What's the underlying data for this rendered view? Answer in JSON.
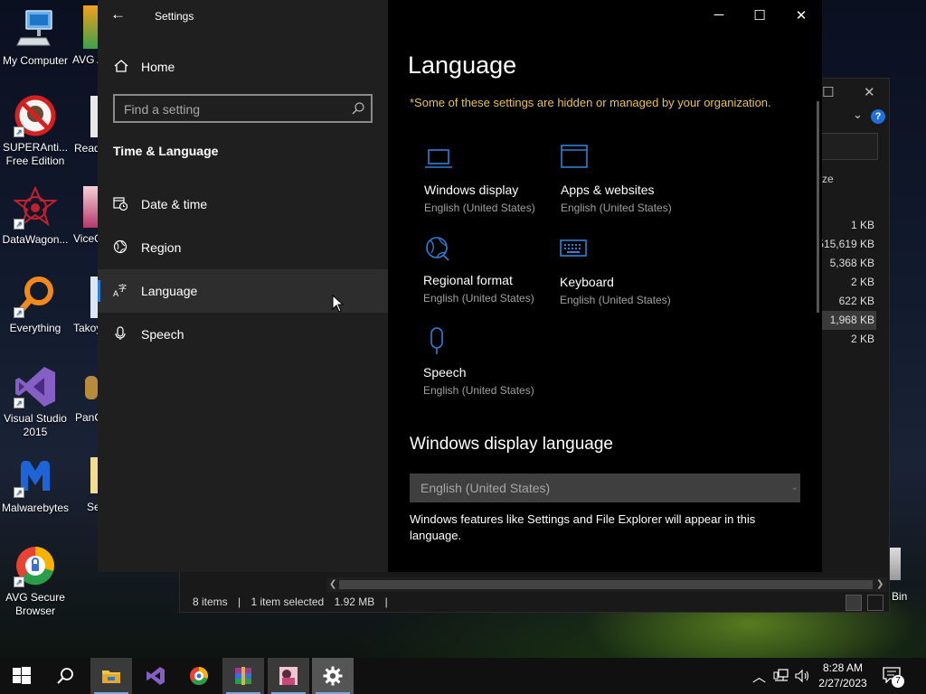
{
  "desktop": {
    "icons": [
      {
        "label": "My Computer",
        "icon": "computer-icon"
      },
      {
        "label": "SUPERAnti... Free Edition",
        "icon": "superantispyware-icon"
      },
      {
        "label": "DataWagon...",
        "icon": "datawagon-icon"
      },
      {
        "label": "Everything",
        "icon": "everything-search-icon"
      },
      {
        "label": "Visual Studio 2015",
        "icon": "visual-studio-icon"
      },
      {
        "label": "Malwarebytes",
        "icon": "malwarebytes-icon"
      },
      {
        "label": "AVG Secure Browser",
        "icon": "avg-browser-icon"
      }
    ],
    "partial_labels": [
      "AVG A",
      "Read",
      "ViceC",
      "Takoy",
      "PanC",
      "Se"
    ],
    "recycle_bin_label": "Bin"
  },
  "explorer": {
    "size_header": "ze",
    "sizes": [
      "1 KB",
      "515,619 KB",
      "5,368 KB",
      "2 KB",
      "622 KB",
      "1,968 KB",
      "2 KB"
    ],
    "selected_index": 5,
    "status": {
      "items": "8 items",
      "selected": "1 item selected",
      "size": "1.92 MB"
    }
  },
  "settings": {
    "window_title": "Settings",
    "home_label": "Home",
    "search_placeholder": "Find a setting",
    "section_title": "Time & Language",
    "nav_items": [
      {
        "label": "Date & time",
        "icon": "date-time-icon"
      },
      {
        "label": "Region",
        "icon": "region-globe-icon"
      },
      {
        "label": "Language",
        "icon": "language-icon",
        "active": true
      },
      {
        "label": "Speech",
        "icon": "microphone-icon"
      }
    ],
    "page_title": "Language",
    "managed_notice": "*Some of these settings are hidden or managed by your organization.",
    "tiles": [
      {
        "title": "Windows display",
        "subtitle": "English (United States)",
        "icon": "laptop-icon"
      },
      {
        "title": "Apps & websites",
        "subtitle": "English (United States)",
        "icon": "window-icon"
      },
      {
        "title": "Regional format",
        "subtitle": "English (United States)",
        "icon": "regional-format-icon"
      },
      {
        "title": "Keyboard",
        "subtitle": "English (United States)",
        "icon": "keyboard-icon"
      },
      {
        "title": "Speech",
        "subtitle": "English (United States)",
        "icon": "microphone-icon"
      }
    ],
    "display_language_heading": "Windows display language",
    "display_language_value": "English (United States)",
    "display_language_desc": "Windows features like Settings and File Explorer will appear in this language.",
    "accent_color": "#2f7fd8",
    "notice_color": "#e8c15a"
  },
  "taskbar": {
    "apps": [
      "start-icon",
      "search-icon",
      "file-explorer-icon",
      "visual-studio-icon",
      "avg-browser-icon",
      "winrar-icon",
      "photo-app-icon",
      "settings-gear-icon"
    ],
    "time": "8:28 AM",
    "date": "2/27/2023",
    "notification_count": "7"
  }
}
